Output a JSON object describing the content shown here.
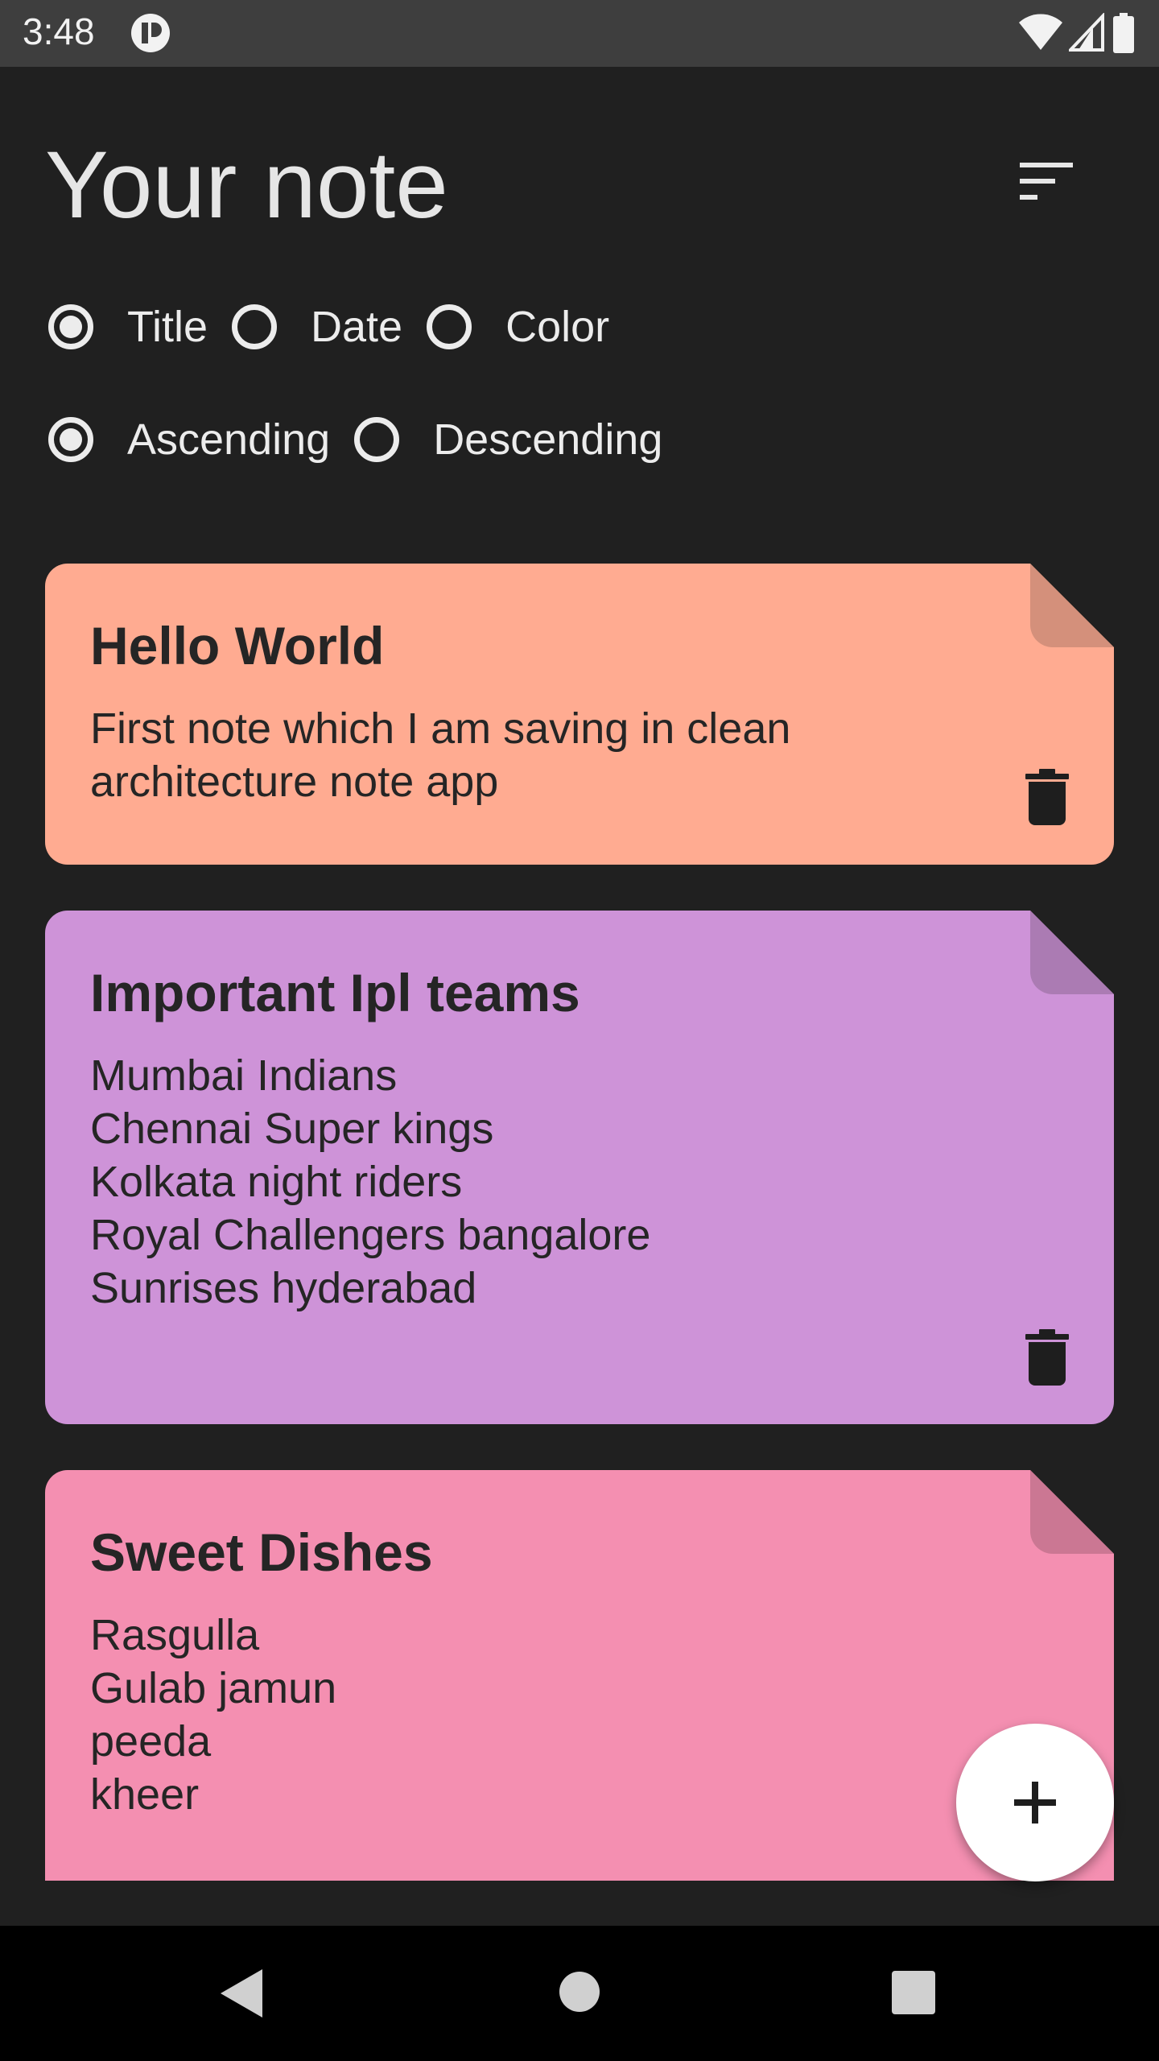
{
  "status_bar": {
    "time": "3:48",
    "icons": [
      "app-notification-icon",
      "wifi-icon",
      "signal-icon",
      "battery-icon"
    ]
  },
  "header": {
    "title": "Your note",
    "sort_icon": "sort-icon"
  },
  "sort_by": {
    "options": [
      {
        "label": "Title",
        "checked": true
      },
      {
        "label": "Date",
        "checked": false
      },
      {
        "label": "Color",
        "checked": false
      }
    ]
  },
  "order": {
    "options": [
      {
        "label": "Ascending",
        "checked": true
      },
      {
        "label": "Descending",
        "checked": false
      }
    ]
  },
  "notes": [
    {
      "title": "Hello World",
      "content": "First note which I am saving in clean\narchitecture note app",
      "color": "#ffab91"
    },
    {
      "title": "Important Ipl teams",
      "content": "Mumbai Indians\nChennai Super kings\nKolkata night riders\nRoyal Challengers bangalore\nSunrises hyderabad",
      "color": "#ce93d8"
    },
    {
      "title": "Sweet Dishes",
      "content": "Rasgulla\nGulab jamun\npeeda\nkheer",
      "color": "#f48fb1"
    }
  ],
  "fab": {
    "icon": "plus-icon"
  },
  "nav_bar": {
    "icons": [
      "back-icon",
      "home-icon",
      "recents-icon"
    ]
  },
  "colors": {
    "background": "#202020",
    "status_bar": "#3e3e3e",
    "nav_bar": "#000000",
    "text": "#ececec"
  }
}
